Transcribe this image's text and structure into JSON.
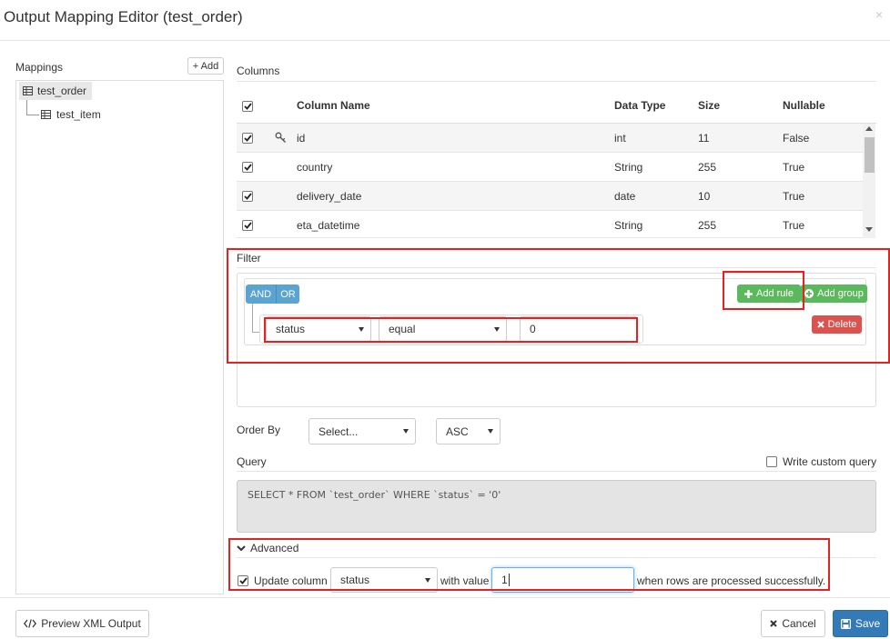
{
  "dialog": {
    "title": "Output Mapping Editor (test_order)",
    "close_label": "×"
  },
  "mappings": {
    "label": "Mappings",
    "add_label": "+ Add",
    "tree": {
      "root": "test_order",
      "child": "test_item"
    }
  },
  "columns": {
    "label": "Columns",
    "headers": [
      "Column Name",
      "Data Type",
      "Size",
      "Nullable"
    ],
    "rows": [
      {
        "name": "id",
        "type": "int",
        "size": "11",
        "nullable": "False",
        "checked": true,
        "key": true
      },
      {
        "name": "country",
        "type": "String",
        "size": "255",
        "nullable": "True",
        "checked": true,
        "key": false
      },
      {
        "name": "delivery_date",
        "type": "date",
        "size": "10",
        "nullable": "True",
        "checked": true,
        "key": false
      },
      {
        "name": "eta_datetime",
        "type": "String",
        "size": "255",
        "nullable": "True",
        "checked": true,
        "key": false
      }
    ]
  },
  "filter": {
    "label": "Filter",
    "and_label": "AND",
    "or_label": "OR",
    "add_rule_label": "Add rule",
    "add_group_label": "Add group",
    "delete_label": "Delete",
    "rule": {
      "field": "status",
      "operator": "equal",
      "value": "0"
    }
  },
  "order_by": {
    "label": "Order By",
    "select_placeholder": "Select...",
    "direction": "ASC"
  },
  "query": {
    "label": "Query",
    "custom_label": "Write custom query",
    "custom_checked": false,
    "sql": "SELECT * FROM `test_order` WHERE `status` = '0'"
  },
  "advanced": {
    "label": "Advanced",
    "update_label": "Update column",
    "update_checked": true,
    "column": "status",
    "with_value_label": "with value",
    "value": "1",
    "suffix": "when rows are processed successfully."
  },
  "footer": {
    "preview_label": "Preview XML Output",
    "cancel_label": "Cancel",
    "save_label": "Save"
  },
  "colors": {
    "primary": "#337ab7",
    "success": "#5cb85c",
    "danger": "#d9534f",
    "info": "#5ba3d0",
    "highlight": "#e52222"
  }
}
